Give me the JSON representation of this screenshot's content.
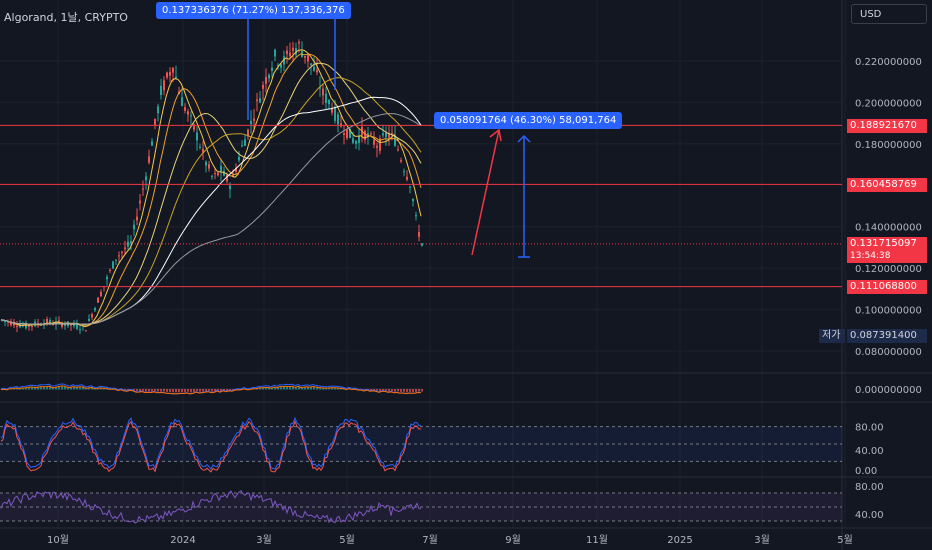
{
  "header": {
    "symbol": "Algorand, 1날, CRYPTO",
    "currency": "USD"
  },
  "measure_labels": {
    "top": "0.137336376 (71.27%) 137,336,376",
    "right": "0.058091764 (46.30%) 58,091,764"
  },
  "price_tags": {
    "h1": "0.188921670",
    "h2": "0.160458769",
    "current": "0.131715097",
    "countdown": "13:54:38",
    "h3": "0.111068800",
    "low_label": "저가",
    "low_value": "0.087391400"
  },
  "colors": {
    "background": "#131722",
    "up": "#26a69a",
    "down": "#ef5350",
    "hline": "#f23645",
    "accent": "#2962ff",
    "stoch_k": "#2962ff",
    "stoch_d": "#ef5350",
    "rsi": "#7e57c2"
  },
  "chart_data": {
    "type": "candlestick",
    "price_axis": {
      "ticks": [
        "0.220000000",
        "0.200000000",
        "0.180000000",
        "0.140000000",
        "0.120000000",
        "0.100000000",
        "0.080000000"
      ],
      "tick_values": [
        0.22,
        0.2,
        0.18,
        0.14,
        0.12,
        0.1,
        0.08
      ],
      "range": [
        0.074,
        0.232
      ]
    },
    "time_axis": {
      "labels": [
        "10월",
        "2024",
        "3월",
        "5월",
        "7월",
        "9월",
        "11월",
        "2025",
        "3월",
        "5월"
      ]
    },
    "horizontal_lines": [
      0.18892167,
      0.160458769,
      0.1110688
    ],
    "current_price": 0.131715097,
    "price_path": [
      [
        0,
        0.095
      ],
      [
        25,
        0.092
      ],
      [
        45,
        0.094
      ],
      [
        65,
        0.093
      ],
      [
        85,
        0.091
      ],
      [
        100,
        0.108
      ],
      [
        115,
        0.125
      ],
      [
        130,
        0.132
      ],
      [
        145,
        0.165
      ],
      [
        160,
        0.205
      ],
      [
        172,
        0.218
      ],
      [
        180,
        0.202
      ],
      [
        188,
        0.193
      ],
      [
        196,
        0.184
      ],
      [
        204,
        0.172
      ],
      [
        212,
        0.163
      ],
      [
        220,
        0.167
      ],
      [
        230,
        0.16
      ],
      [
        240,
        0.177
      ],
      [
        250,
        0.19
      ],
      [
        258,
        0.202
      ],
      [
        266,
        0.213
      ],
      [
        274,
        0.222
      ],
      [
        282,
        0.219
      ],
      [
        290,
        0.225
      ],
      [
        298,
        0.227
      ],
      [
        306,
        0.222
      ],
      [
        314,
        0.215
      ],
      [
        322,
        0.204
      ],
      [
        330,
        0.199
      ],
      [
        338,
        0.19
      ],
      [
        346,
        0.186
      ],
      [
        354,
        0.181
      ],
      [
        362,
        0.186
      ],
      [
        370,
        0.182
      ],
      [
        378,
        0.179
      ],
      [
        386,
        0.185
      ],
      [
        394,
        0.182
      ],
      [
        402,
        0.17
      ],
      [
        410,
        0.16
      ],
      [
        416,
        0.14
      ],
      [
        421,
        0.132
      ]
    ],
    "oscillators": {
      "macd": {
        "zero_label": "0.000000000"
      },
      "stochastic": {
        "ticks": [
          "80.00",
          "40.00",
          "0.00"
        ],
        "tick_values": [
          80,
          40,
          0
        ]
      },
      "rsi": {
        "ticks": [
          "80.00",
          "40.00"
        ],
        "tick_values": [
          80,
          40
        ]
      }
    }
  }
}
